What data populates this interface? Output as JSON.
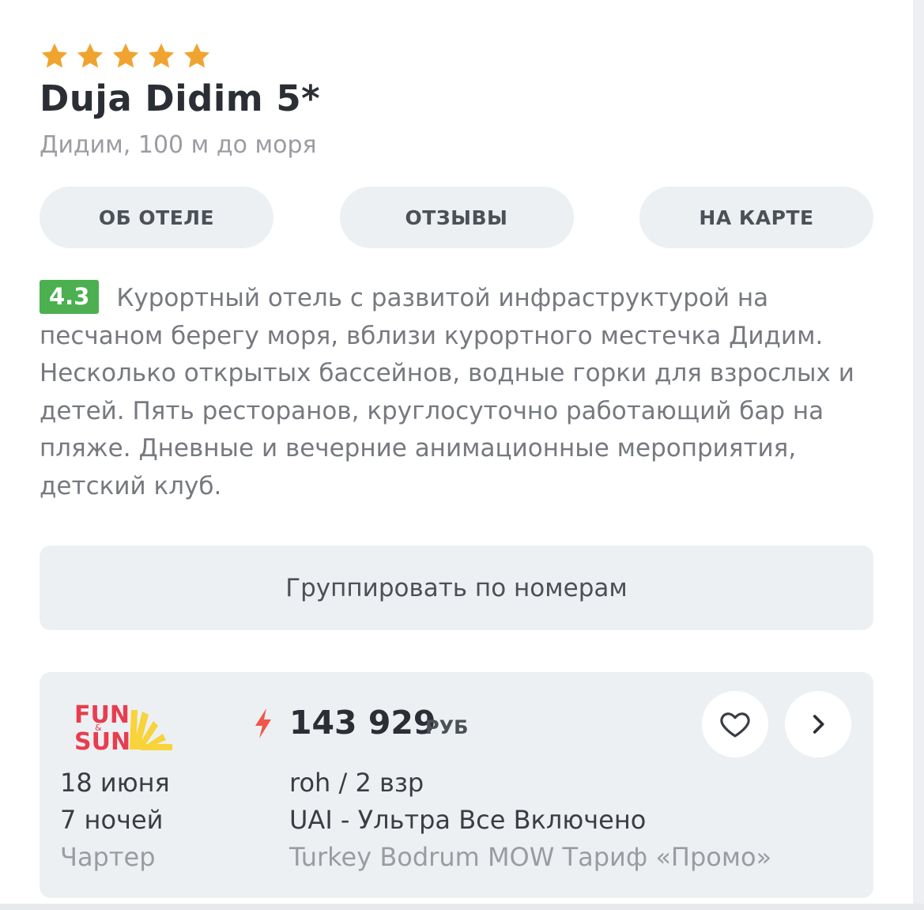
{
  "hotel": {
    "stars": 5,
    "title": "Duja Didim 5*",
    "location": "Дидим, 100 м до моря",
    "rating": "4.3",
    "description": "Курортный отель с развитой инфраструктурой на песчаном берегу моря, вблизи курортного местечка Дидим. Несколько открытых бассейнов, водные горки для взрослых и детей. Пять ресторанов, круглосуточно работающий бар на пляже. Дневные и вечерние анимационные мероприятия, детский клуб."
  },
  "tabs": [
    {
      "label": "ОБ ОТЕЛЕ"
    },
    {
      "label": "ОТЗЫВЫ"
    },
    {
      "label": "НА КАРТЕ"
    }
  ],
  "group_button": {
    "label": "Группировать по номерам"
  },
  "offer": {
    "operator_logo": {
      "line1": "FUN",
      "line2": "SUN",
      "connector": "&"
    },
    "date": "18 июня",
    "nights": "7 ночей",
    "flight_type": "Чартер",
    "price": "143 929",
    "currency": "РУБ",
    "room": "roh / 2 взр",
    "meal": "UAI - Ультра Все Включено",
    "tariff": "Turkey Bodrum MOW Тариф «Промо»",
    "icons": {
      "price_marker": "lightning-icon",
      "favorite": "heart-icon",
      "open": "chevron-right-icon"
    }
  },
  "colors": {
    "star": "#f0a430",
    "rating_badge": "#4caf50",
    "bolt": "#f2554a",
    "logo_red": "#e83d4f",
    "logo_yellow": "#f8d33a",
    "tab_bg": "#edf0f3"
  }
}
